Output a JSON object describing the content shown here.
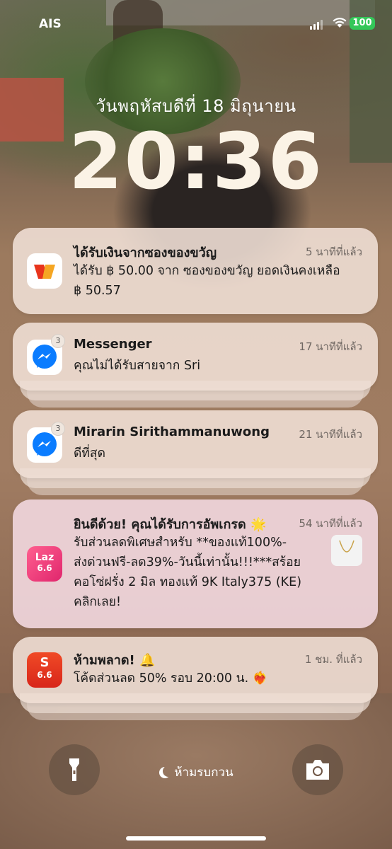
{
  "status_bar": {
    "carrier": "AIS",
    "battery": "100"
  },
  "lock_screen": {
    "date": "วันพฤหัสบดีที่ 18 มิถุนายน",
    "time": "20:36"
  },
  "notifications": [
    {
      "app_icon": "wallet-app-icon",
      "title": "ได้รับเงินจากซองของขวัญ",
      "time": "5 นาทีที่แล้ว",
      "body_line1": "ได้รับ ฿ 50.00 จาก ซองของขวัญ ยอดเงินคงเหลือ",
      "body_line2": "฿ 50.57"
    },
    {
      "app_icon": "messenger-icon",
      "badge": "3",
      "title": "Messenger",
      "time": "17 นาทีที่แล้ว",
      "body_line1": "คุณไม่ได้รับสายจาก Sri"
    },
    {
      "app_icon": "messenger-icon",
      "badge": "3",
      "title": "Mirarin Sirithammanuwong",
      "time": "21 นาทีที่แล้ว",
      "body_line1": "ดีที่สุด"
    },
    {
      "app_icon": "lazada-icon",
      "icon_text_top": "Laz",
      "icon_text_bottom": "6.6",
      "title": "ยินดีด้วย! คุณได้รับการอัพเกรด 🌟",
      "time": "54 นาทีที่แล้ว",
      "body_line1": " รับส่วนลดพิเศษสำหรับ **ของแท้100%-",
      "body_line2": "ส่งด่วนฟรี-ลด39%-วันนี้เท่านั้น!!!***สร้อย",
      "body_line3": "คอโซ่ฝรั่ง 2 มิล ทองแท้ 9K Italy375 (KE)",
      "body_line4": "คลิกเลย!"
    },
    {
      "app_icon": "shopee-icon",
      "icon_text_top": "S",
      "icon_text_bottom": "6.6",
      "title": "ห้ามพลาด! 🔔",
      "time": "1 ชม. ที่แล้ว",
      "body_line1": "โค้ดส่วนลด 50% รอบ 20:00 น. ❤️‍🔥"
    }
  ],
  "bottom": {
    "focus_label": "ห้ามรบกวน",
    "focus_icon": "moon-icon",
    "left_icon": "flashlight-icon",
    "right_icon": "camera-icon"
  },
  "colors": {
    "battery": "#34c759",
    "messenger": "#0a7cff",
    "lazada": "#f0327a",
    "shopee": "#e8341c"
  }
}
